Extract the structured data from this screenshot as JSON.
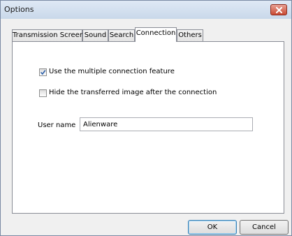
{
  "window": {
    "title": "Options"
  },
  "tabs": [
    {
      "label": "Transmission Screen",
      "active": false
    },
    {
      "label": "Sound",
      "active": false
    },
    {
      "label": "Search",
      "active": false
    },
    {
      "label": "Connection",
      "active": true
    },
    {
      "label": "Others",
      "active": false
    }
  ],
  "connection": {
    "multiple_connection": {
      "label": "Use the multiple connection feature",
      "checked": true
    },
    "hide_transferred": {
      "label": "Hide the transferred image after the connection",
      "checked": false
    },
    "user_name": {
      "label": "User name",
      "value": "Alienware"
    }
  },
  "buttons": {
    "ok": "OK",
    "cancel": "Cancel"
  }
}
